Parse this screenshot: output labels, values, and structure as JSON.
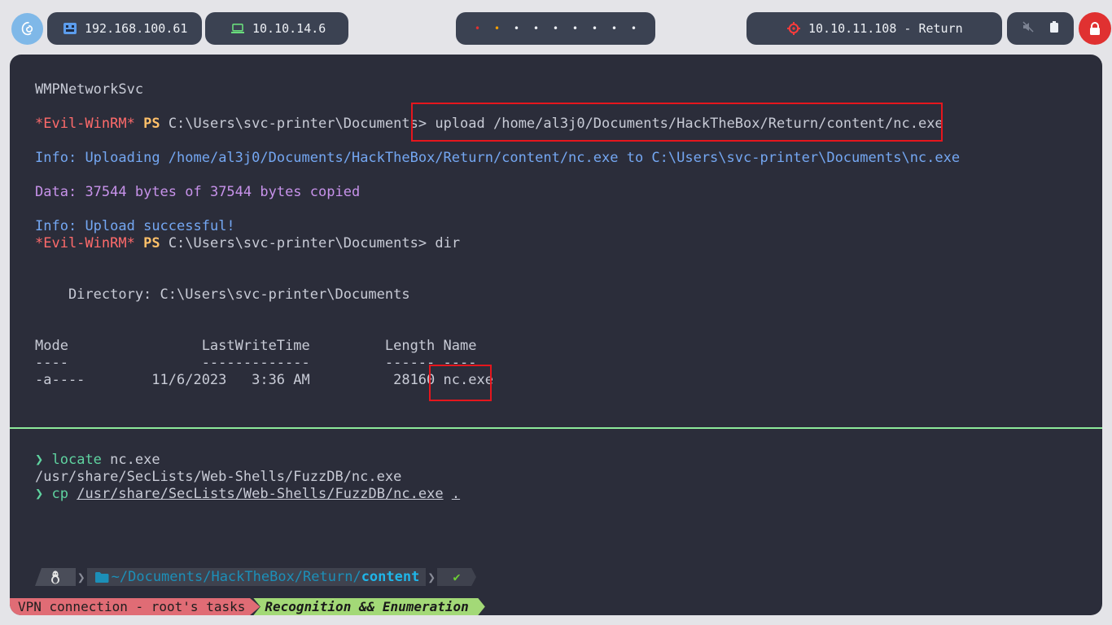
{
  "topbar": {
    "host_ip": "192.168.100.61",
    "vpn_ip": "10.10.14.6",
    "workspace_dots": [
      "•",
      "•",
      "•",
      "•",
      "•",
      "•",
      "•",
      "•",
      "•"
    ],
    "workspace_colors": [
      "#e03131",
      "#f59f00",
      "#eceff4",
      "#eceff4",
      "#eceff4",
      "#eceff4",
      "#eceff4",
      "#eceff4",
      "#eceff4"
    ],
    "target": "10.10.11.108 - Return",
    "icons": [
      "debian-icon",
      "network-icon",
      "laptop-icon",
      "target-icon",
      "mute-icon",
      "battery-icon",
      "lock-icon"
    ]
  },
  "top_pane": {
    "l1": "WMPNetworkSvc",
    "evil": "*Evil-WinRM*",
    "ps": "PS",
    "cwd": "C:\\Users\\svc-printer\\Documents>",
    "upload_cmd": "upload /home/al3j0/Documents/HackTheBox/Return/content/nc.exe",
    "info_label": "Info:",
    "info_upload": "Uploading /home/al3j0/Documents/HackTheBox/Return/content/nc.exe to C:\\Users\\svc-printer\\Documents\\nc.exe",
    "data_label": "Data:",
    "data_text": "37544 bytes of 37544 bytes copied",
    "info_success": "Upload successful!",
    "dir_cmd": "dir",
    "directory": "    Directory: C:\\Users\\svc-printer\\Documents",
    "header": "Mode                LastWriteTime         Length Name",
    "underline": "----                -------------         ------ ----",
    "row": "-a----        11/6/2023   3:36 AM          28160 ",
    "row_name": "nc.exe"
  },
  "bottom_pane": {
    "arrow": "❯",
    "cmd1": "locate",
    "cmd1_arg": " nc.exe",
    "out1": "/usr/share/SecLists/Web-Shells/FuzzDB/nc.exe",
    "cmd2": "cp",
    "cmd2_arg": "/usr/share/SecLists/Web-Shells/FuzzDB/nc.exe",
    "cmd2_dot": ".",
    "prompt_path": "~/Documents/HackTheBox/Return/",
    "prompt_dir": "content",
    "prompt_ok": "✔"
  },
  "statusbar": {
    "left": "VPN connection - root's tasks",
    "right": "Recognition && Enumeration"
  }
}
